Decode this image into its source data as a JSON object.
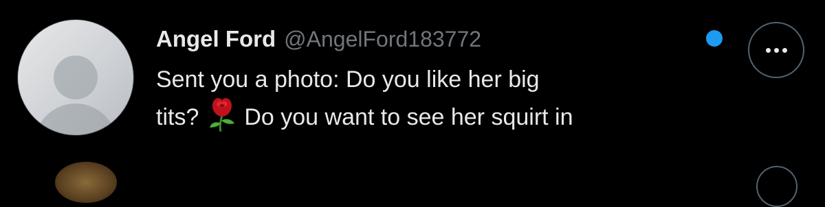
{
  "conversation": {
    "display_name": "Angel Ford",
    "handle": "@AngelFord183772",
    "message_line_1": "Sent you a photo: Do you like her big",
    "message_line_2_start": "tits?",
    "message_line_2_end": "Do you want to see her squirt in",
    "emoji": "rose-icon",
    "unread": true
  },
  "actions": {
    "more_icon": "ellipsis-icon"
  },
  "colors": {
    "background": "#000000",
    "primary_text": "#e7e9ea",
    "secondary_text": "#71767b",
    "unread_dot": "#1d9bf0",
    "border": "#536471"
  }
}
